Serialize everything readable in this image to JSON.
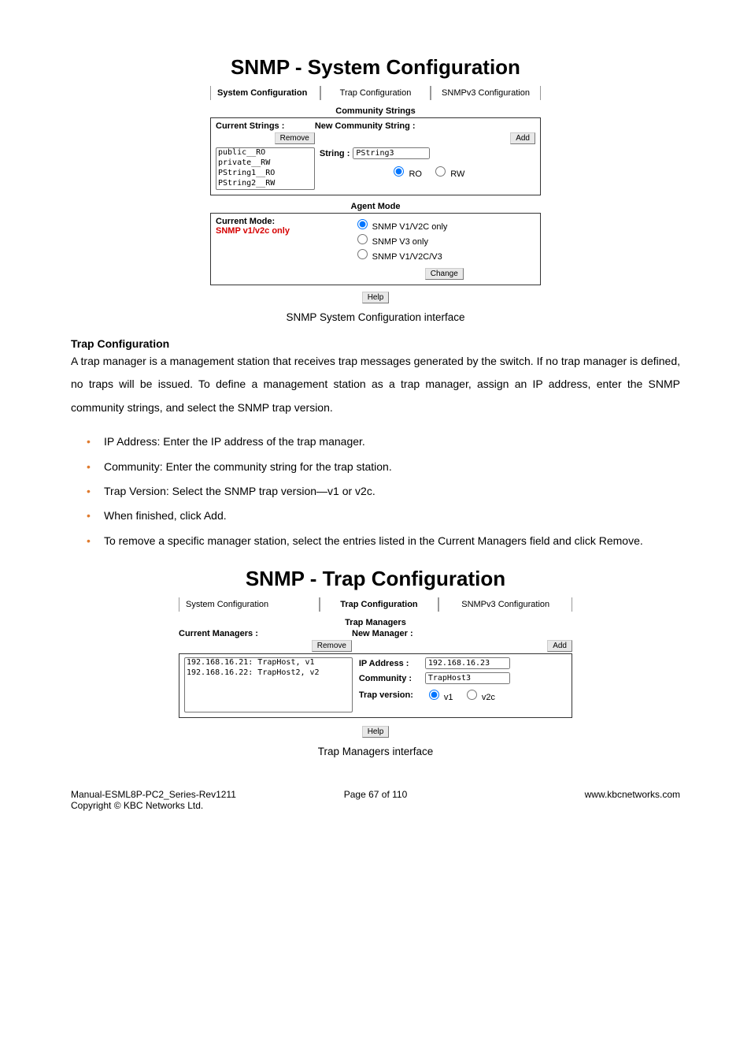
{
  "fig1": {
    "title": "SNMP - System Configuration",
    "tabs": [
      "System Configuration",
      "Trap Configuration",
      "SNMPv3 Configuration"
    ],
    "active_tab": 0,
    "community": {
      "heading": "Community Strings",
      "current_label": "Current Strings :",
      "remove_btn": "Remove",
      "items": [
        "public__RO",
        "private__RW",
        "PString1__RO",
        "PString2__RW"
      ],
      "new_label": "New Community String :",
      "add_btn": "Add",
      "string_label": "String :",
      "string_value": "PString3",
      "ro": "RO",
      "rw": "RW",
      "ro_checked": true
    },
    "agent": {
      "heading": "Agent Mode",
      "current_mode_label": "Current Mode:",
      "current_mode_value": "SNMP v1/v2c only",
      "options": [
        "SNMP V1/V2C only",
        "SNMP V3 only",
        "SNMP V1/V2C/V3"
      ],
      "checked": 0,
      "change_btn": "Change"
    },
    "help_btn": "Help",
    "caption": "SNMP System Configuration interface"
  },
  "text": {
    "trap_heading": "Trap Configuration",
    "trap_para": "A trap manager is a management station that receives trap messages generated by the switch. If no trap manager is defined, no traps will be issued. To define a management station as a trap manager, assign an IP address, enter the SNMP community strings, and select the SNMP trap version.",
    "bullets": [
      "IP Address: Enter the IP address of the trap manager.",
      "Community: Enter the community string for the trap station.",
      "Trap Version: Select the SNMP trap version—v1 or v2c.",
      "When finished, click Add.",
      "To remove a specific manager station, select the entries listed in the Current Managers field and click Remove."
    ]
  },
  "fig2": {
    "title": "SNMP - Trap Configuration",
    "tabs": [
      "System Configuration",
      "Trap Configuration",
      "SNMPv3 Configuration"
    ],
    "active_tab": 1,
    "managers": {
      "heading": "Trap Managers",
      "current_label": "Current Managers :",
      "remove_btn": "Remove",
      "items": [
        "192.168.16.21: TrapHost, v1",
        "192.168.16.22: TrapHost2, v2"
      ],
      "new_label": "New Manager :",
      "add_btn": "Add",
      "ip_label": "IP Address :",
      "ip_value": "192.168.16.23",
      "community_label": "Community :",
      "community_value": "TrapHost3",
      "trapver_label": "Trap version:",
      "v1": "v1",
      "v2c": "v2c",
      "v1_checked": true
    },
    "help_btn": "Help",
    "caption": "Trap Managers interface"
  },
  "footer": {
    "left1": "Manual-ESML8P-PC2_Series-Rev1211",
    "left2": "Copyright © KBC Networks Ltd.",
    "center": "Page 67 of 110",
    "right": "www.kbcnetworks.com"
  }
}
